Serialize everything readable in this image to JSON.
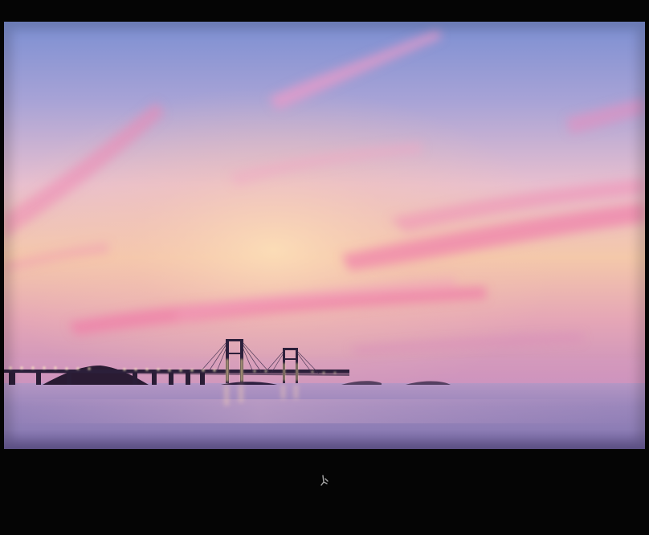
{
  "photo": {
    "subject": "sunset-sea-bridge",
    "colors": {
      "sky_top": "#7f8fd3",
      "sky_mid": "#d8a9c9",
      "sky_glow": "#f3c7a8",
      "horizon": "#c58fb7",
      "sea_top": "#9a86b8",
      "sea_bottom": "#6b5a94",
      "cloud_pink": "#ef7fb0",
      "bridge": "#2c1f3a",
      "lights": "#ffe7a0"
    }
  },
  "signature_mark": {
    "icon": "signature-glyph"
  }
}
